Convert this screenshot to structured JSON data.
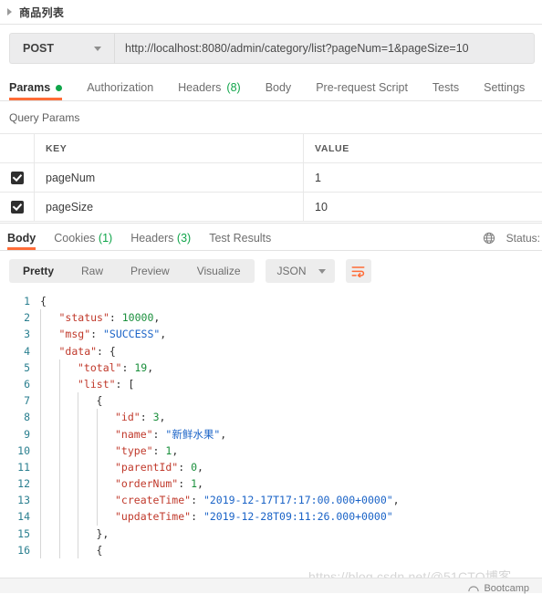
{
  "request_tab": {
    "title": "商品列表",
    "caret_icon": "triangle-right-icon"
  },
  "url_bar": {
    "method": "POST",
    "method_caret_icon": "chevron-down-icon",
    "url": "http://localhost:8080/admin/category/list?pageNum=1&pageSize=10"
  },
  "request_tabs": [
    {
      "label": "Params",
      "active": true,
      "dot": true
    },
    {
      "label": "Authorization",
      "active": false
    },
    {
      "label": "Headers",
      "count": "(8)",
      "active": false
    },
    {
      "label": "Body",
      "active": false
    },
    {
      "label": "Pre-request Script",
      "active": false
    },
    {
      "label": "Tests",
      "active": false
    },
    {
      "label": "Settings",
      "active": false
    }
  ],
  "query_params": {
    "section_title": "Query Params",
    "columns": [
      "KEY",
      "VALUE"
    ],
    "rows": [
      {
        "checked": true,
        "key": "pageNum",
        "value": "1"
      },
      {
        "checked": true,
        "key": "pageSize",
        "value": "10"
      }
    ]
  },
  "response_tabs": [
    {
      "label": "Body",
      "active": true
    },
    {
      "label": "Cookies",
      "count": "(1)",
      "active": false
    },
    {
      "label": "Headers",
      "count": "(3)",
      "active": false
    },
    {
      "label": "Test Results",
      "active": false
    }
  ],
  "response_meta": {
    "globe_icon": "globe-icon",
    "status_label": "Status:"
  },
  "view_toolbar": {
    "modes": [
      {
        "label": "Pretty",
        "active": true
      },
      {
        "label": "Raw",
        "active": false
      },
      {
        "label": "Preview",
        "active": false
      },
      {
        "label": "Visualize",
        "active": false
      }
    ],
    "format": "JSON",
    "format_caret_icon": "chevron-down-icon",
    "wrap_icon": "word-wrap-icon"
  },
  "code_lines": [
    {
      "n": "1",
      "indent": 0,
      "guides": 0,
      "tokens": [
        {
          "t": "p",
          "v": "{"
        }
      ]
    },
    {
      "n": "2",
      "indent": 1,
      "guides": 1,
      "tokens": [
        {
          "t": "k",
          "v": "\"status\""
        },
        {
          "t": "p",
          "v": ": "
        },
        {
          "t": "n",
          "v": "10000"
        },
        {
          "t": "p",
          "v": ","
        }
      ]
    },
    {
      "n": "3",
      "indent": 1,
      "guides": 1,
      "tokens": [
        {
          "t": "k",
          "v": "\"msg\""
        },
        {
          "t": "p",
          "v": ": "
        },
        {
          "t": "s",
          "v": "\"SUCCESS\""
        },
        {
          "t": "p",
          "v": ","
        }
      ]
    },
    {
      "n": "4",
      "indent": 1,
      "guides": 1,
      "tokens": [
        {
          "t": "k",
          "v": "\"data\""
        },
        {
          "t": "p",
          "v": ": {"
        }
      ]
    },
    {
      "n": "5",
      "indent": 2,
      "guides": 2,
      "tokens": [
        {
          "t": "k",
          "v": "\"total\""
        },
        {
          "t": "p",
          "v": ": "
        },
        {
          "t": "n",
          "v": "19"
        },
        {
          "t": "p",
          "v": ","
        }
      ]
    },
    {
      "n": "6",
      "indent": 2,
      "guides": 2,
      "tokens": [
        {
          "t": "k",
          "v": "\"list\""
        },
        {
          "t": "p",
          "v": ": ["
        }
      ]
    },
    {
      "n": "7",
      "indent": 3,
      "guides": 3,
      "tokens": [
        {
          "t": "p",
          "v": "{"
        }
      ]
    },
    {
      "n": "8",
      "indent": 4,
      "guides": 4,
      "tokens": [
        {
          "t": "k",
          "v": "\"id\""
        },
        {
          "t": "p",
          "v": ": "
        },
        {
          "t": "n",
          "v": "3"
        },
        {
          "t": "p",
          "v": ","
        }
      ]
    },
    {
      "n": "9",
      "indent": 4,
      "guides": 4,
      "tokens": [
        {
          "t": "k",
          "v": "\"name\""
        },
        {
          "t": "p",
          "v": ": "
        },
        {
          "t": "s",
          "v": "\"新鲜水果\""
        },
        {
          "t": "p",
          "v": ","
        }
      ]
    },
    {
      "n": "10",
      "indent": 4,
      "guides": 4,
      "tokens": [
        {
          "t": "k",
          "v": "\"type\""
        },
        {
          "t": "p",
          "v": ": "
        },
        {
          "t": "n",
          "v": "1"
        },
        {
          "t": "p",
          "v": ","
        }
      ]
    },
    {
      "n": "11",
      "indent": 4,
      "guides": 4,
      "tokens": [
        {
          "t": "k",
          "v": "\"parentId\""
        },
        {
          "t": "p",
          "v": ": "
        },
        {
          "t": "n",
          "v": "0"
        },
        {
          "t": "p",
          "v": ","
        }
      ]
    },
    {
      "n": "12",
      "indent": 4,
      "guides": 4,
      "tokens": [
        {
          "t": "k",
          "v": "\"orderNum\""
        },
        {
          "t": "p",
          "v": ": "
        },
        {
          "t": "n",
          "v": "1"
        },
        {
          "t": "p",
          "v": ","
        }
      ]
    },
    {
      "n": "13",
      "indent": 4,
      "guides": 4,
      "tokens": [
        {
          "t": "k",
          "v": "\"createTime\""
        },
        {
          "t": "p",
          "v": ": "
        },
        {
          "t": "s",
          "v": "\"2019-12-17T17:17:00.000+0000\""
        },
        {
          "t": "p",
          "v": ","
        }
      ]
    },
    {
      "n": "14",
      "indent": 4,
      "guides": 4,
      "tokens": [
        {
          "t": "k",
          "v": "\"updateTime\""
        },
        {
          "t": "p",
          "v": ": "
        },
        {
          "t": "s",
          "v": "\"2019-12-28T09:11:26.000+0000\""
        }
      ]
    },
    {
      "n": "15",
      "indent": 3,
      "guides": 3,
      "tokens": [
        {
          "t": "p",
          "v": "},"
        }
      ]
    },
    {
      "n": "16",
      "indent": 3,
      "guides": 3,
      "tokens": [
        {
          "t": "p",
          "v": "{"
        }
      ]
    }
  ],
  "watermark": {
    "text": "https://blog.csdn.net/@51CTO博客"
  },
  "bottom": {
    "bootcamp_label": "Bootcamp",
    "bootcamp_icon": "bootcamp-icon"
  }
}
